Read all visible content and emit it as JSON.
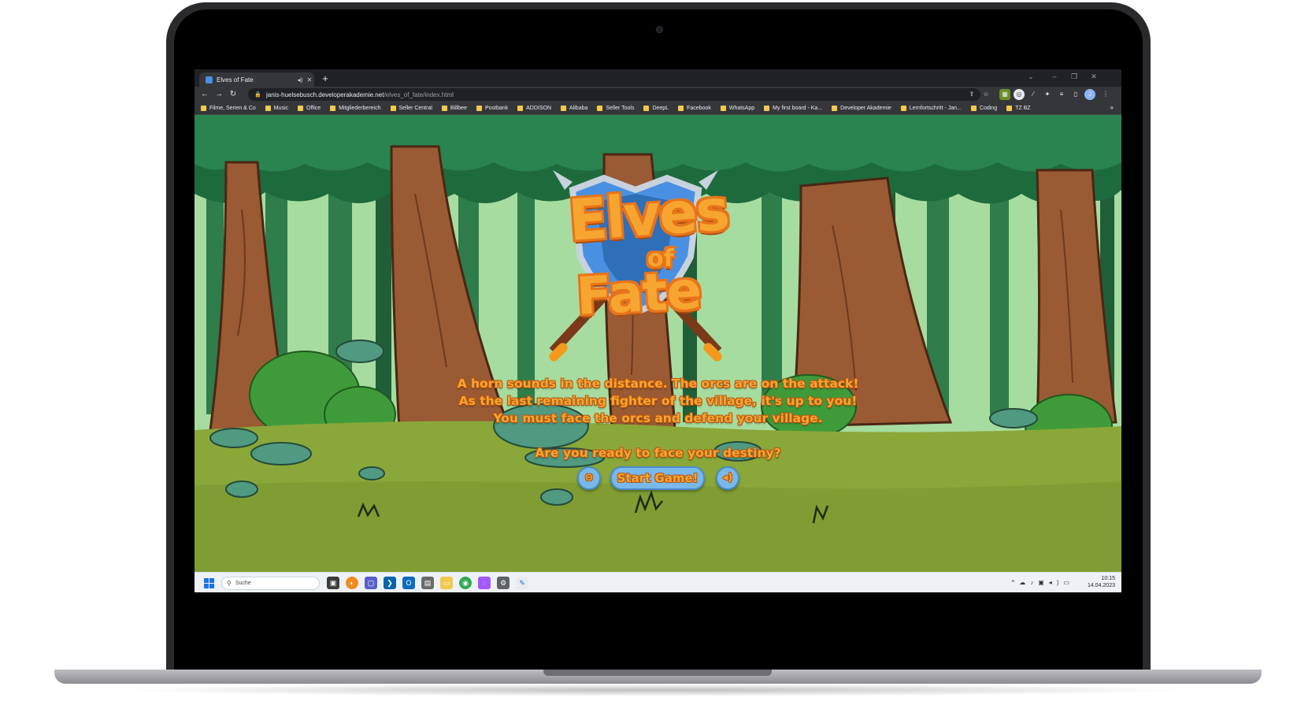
{
  "browser": {
    "tab_title": "Elves of Fate",
    "tab_audio_icon": "speaker-icon",
    "tab_close": "✕",
    "new_tab": "+",
    "url_host": "janis-huelsebusch.developerakademie.net",
    "url_path": "/elves_of_fate/index.html",
    "bookmarks": [
      "Filme, Serien & Co",
      "Music",
      "Office",
      "Mitgliederbereich",
      "Seller Central",
      "Billbee",
      "Postbank",
      "ADDISON",
      "Alibaba",
      "Seller Tools",
      "DeepL",
      "Facebook",
      "WhatsApp",
      "My first board - Ka...",
      "Developer Akademie",
      "Lernfortschritt - Jan...",
      "Coding",
      "TZ BZ"
    ],
    "bookmarks_more": "»"
  },
  "game": {
    "logo_line1": "Elves",
    "logo_line2": "of",
    "logo_line3": "Fate",
    "story_line1": "A horn sounds in the distance. The orcs are on the attack!",
    "story_line2": "As the last remaining fighter of the village, it's up to you!",
    "story_line3": "You must face the orcs and defend your village.",
    "question": "Are you ready to face your destiny?",
    "start_button": "Start Game!",
    "controls_icon": "gamepad-icon",
    "sound_icon": "speaker-icon"
  },
  "taskbar": {
    "search_placeholder": "Suche",
    "time": "10:15",
    "date": "14.04.2023"
  },
  "colors": {
    "title_orange": "#f7a531",
    "button_blue": "#79b8ea",
    "forest_dark": "#2e6b3f",
    "grass": "#8aa83a"
  }
}
